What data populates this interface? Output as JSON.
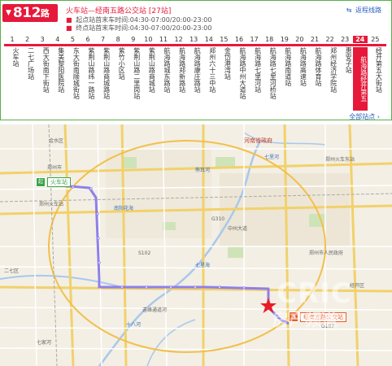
{
  "route": {
    "badge_prefix": "▼",
    "number": "812",
    "suffix": "路",
    "title": "火车站—经南五路公交站",
    "stop_count": "[27站]",
    "hours_start": "起点站首末车时间:04:30-07:00/20:00-23:00",
    "hours_end": "终点站首末车时间:04:30-07:00/20:00-23:00",
    "reverse_link": "返程线路",
    "all_stops_link": "全部站点",
    "current_stop_index": 24,
    "colors": {
      "accent": "#e6193a",
      "border": "#58b04a",
      "link": "#2a60c0"
    }
  },
  "stops": [
    {
      "n": "1",
      "name": "火车站"
    },
    {
      "n": "2",
      "name": "二七广场站"
    },
    {
      "n": "3",
      "name": "西大街南下街站"
    },
    {
      "n": "4",
      "name": "集美黎阳医院站"
    },
    {
      "n": "5",
      "name": "东大街南顺城街站"
    },
    {
      "n": "6",
      "name": "紫荆山路纬一路站"
    },
    {
      "n": "7",
      "name": "紫荆山路商城路站"
    },
    {
      "n": "8",
      "name": "紫竹小区站"
    },
    {
      "n": "9",
      "name": "紫荆山路二里岗站"
    },
    {
      "n": "10",
      "name": "紫荆山路商城站"
    },
    {
      "n": "11",
      "name": "航海路城东路站"
    },
    {
      "n": "12",
      "name": "航海路郑新路站"
    },
    {
      "n": "13",
      "name": "航海路康庄路站"
    },
    {
      "n": "14",
      "name": "郑州六十三中站"
    },
    {
      "n": "15",
      "name": "金岱港湾站"
    },
    {
      "n": "16",
      "name": "航海路中州大道站"
    },
    {
      "n": "17",
      "name": "航海路七里河站"
    },
    {
      "n": "18",
      "name": "航海路七里河桥站"
    },
    {
      "n": "19",
      "name": "航海路南道站"
    },
    {
      "n": "20",
      "name": "航海路高速站"
    },
    {
      "n": "21",
      "name": "航海路体育站"
    },
    {
      "n": "22",
      "name": "郑州经济学院站"
    },
    {
      "n": "23",
      "name": "惠安子站"
    },
    {
      "n": "24",
      "name": "航海路经开第五"
    },
    {
      "n": "25",
      "name": "经开第五大街站"
    }
  ],
  "map": {
    "labels": {
      "jinshui": "金水区",
      "henan_gov": "河南省政府",
      "dongzhan": "郑州火车东站",
      "qilihe": "七里河",
      "zhengzhou_city": "郑州市",
      "zz_station": "郑州火车站",
      "xiongerhe": "熊耳河",
      "nanyanghuahai": "南阳花海",
      "qixinghai": "七星海",
      "shibahe": "十八河",
      "yuanxiandaohe": "遠峰通道河",
      "erqi": "二七区",
      "qisheng": "七家河",
      "g310": "G310",
      "g107": "G107",
      "s102": "S102",
      "zhenghu": "郑州市人民政府",
      "jingkai": "经开区",
      "zhongzhou": "中州大道"
    },
    "start_flag": "起",
    "start_label": "火车站",
    "end_flag": "终",
    "end_label": "经南五路公交站",
    "watermark": "CRIC",
    "watermark_sub": "房产频道"
  }
}
